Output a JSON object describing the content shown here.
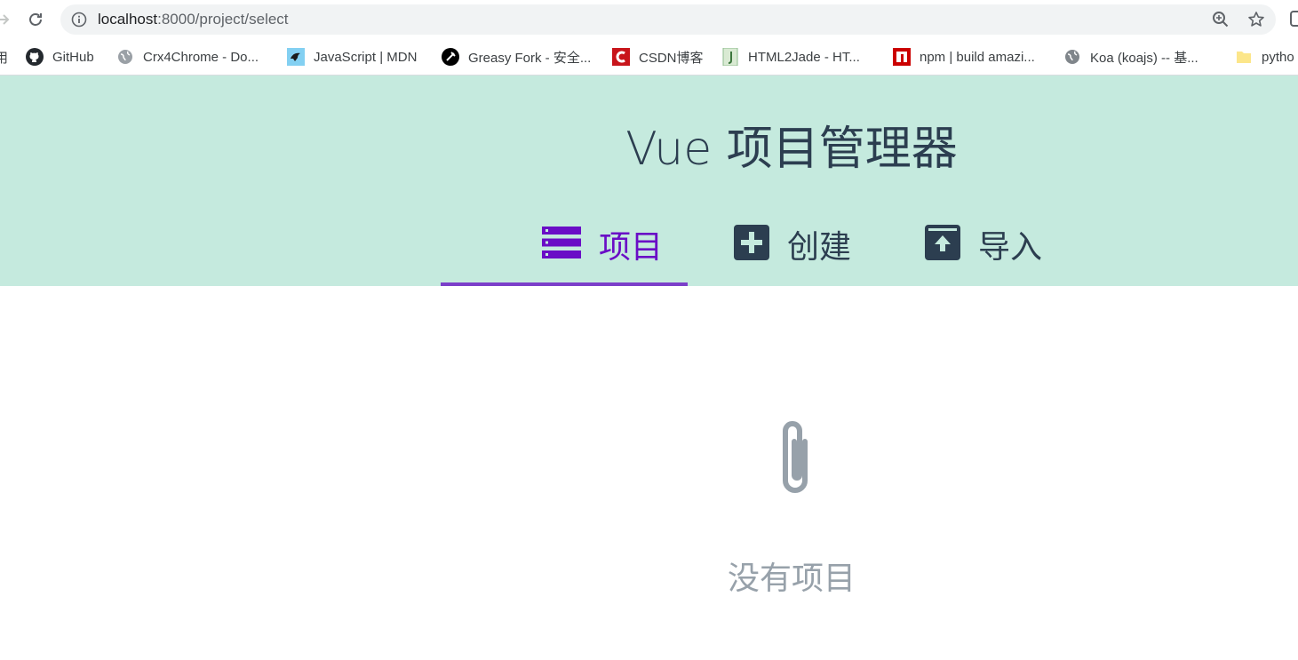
{
  "browser": {
    "url_host": "localhost",
    "url_path": ":8000/project/select",
    "bookmarks_prefix": "用",
    "bookmarks": [
      {
        "label": "GitHub",
        "icon": "github-icon"
      },
      {
        "label": "Crx4Chrome - Do...",
        "icon": "globe-icon"
      },
      {
        "label": "JavaScript | MDN",
        "icon": "mdn-icon"
      },
      {
        "label": "Greasy Fork - 安全...",
        "icon": "greasyfork-icon"
      },
      {
        "label": "CSDN博客",
        "icon": "csdn-icon"
      },
      {
        "label": "HTML2Jade - HT...",
        "icon": "html2jade-icon"
      },
      {
        "label": "npm | build amazi...",
        "icon": "npm-icon"
      },
      {
        "label": "Koa (koajs) -- 基...",
        "icon": "globe-icon"
      },
      {
        "label": "pytho",
        "icon": "folder-icon"
      }
    ]
  },
  "app": {
    "title": "Vue 项目管理器",
    "tabs": [
      {
        "label": "项目",
        "icon": "list-icon",
        "active": true
      },
      {
        "label": "创建",
        "icon": "plus-box-icon",
        "active": false
      },
      {
        "label": "导入",
        "icon": "upload-box-icon",
        "active": false
      }
    ],
    "empty_state": {
      "icon": "paperclip-icon",
      "message": "没有项目"
    }
  },
  "colors": {
    "header_bg": "#c5eade",
    "active_tab": "#6a0dc6",
    "underline": "#7b3fc9",
    "text_dark": "#2c3e50",
    "empty_gray": "#97a1aa"
  }
}
